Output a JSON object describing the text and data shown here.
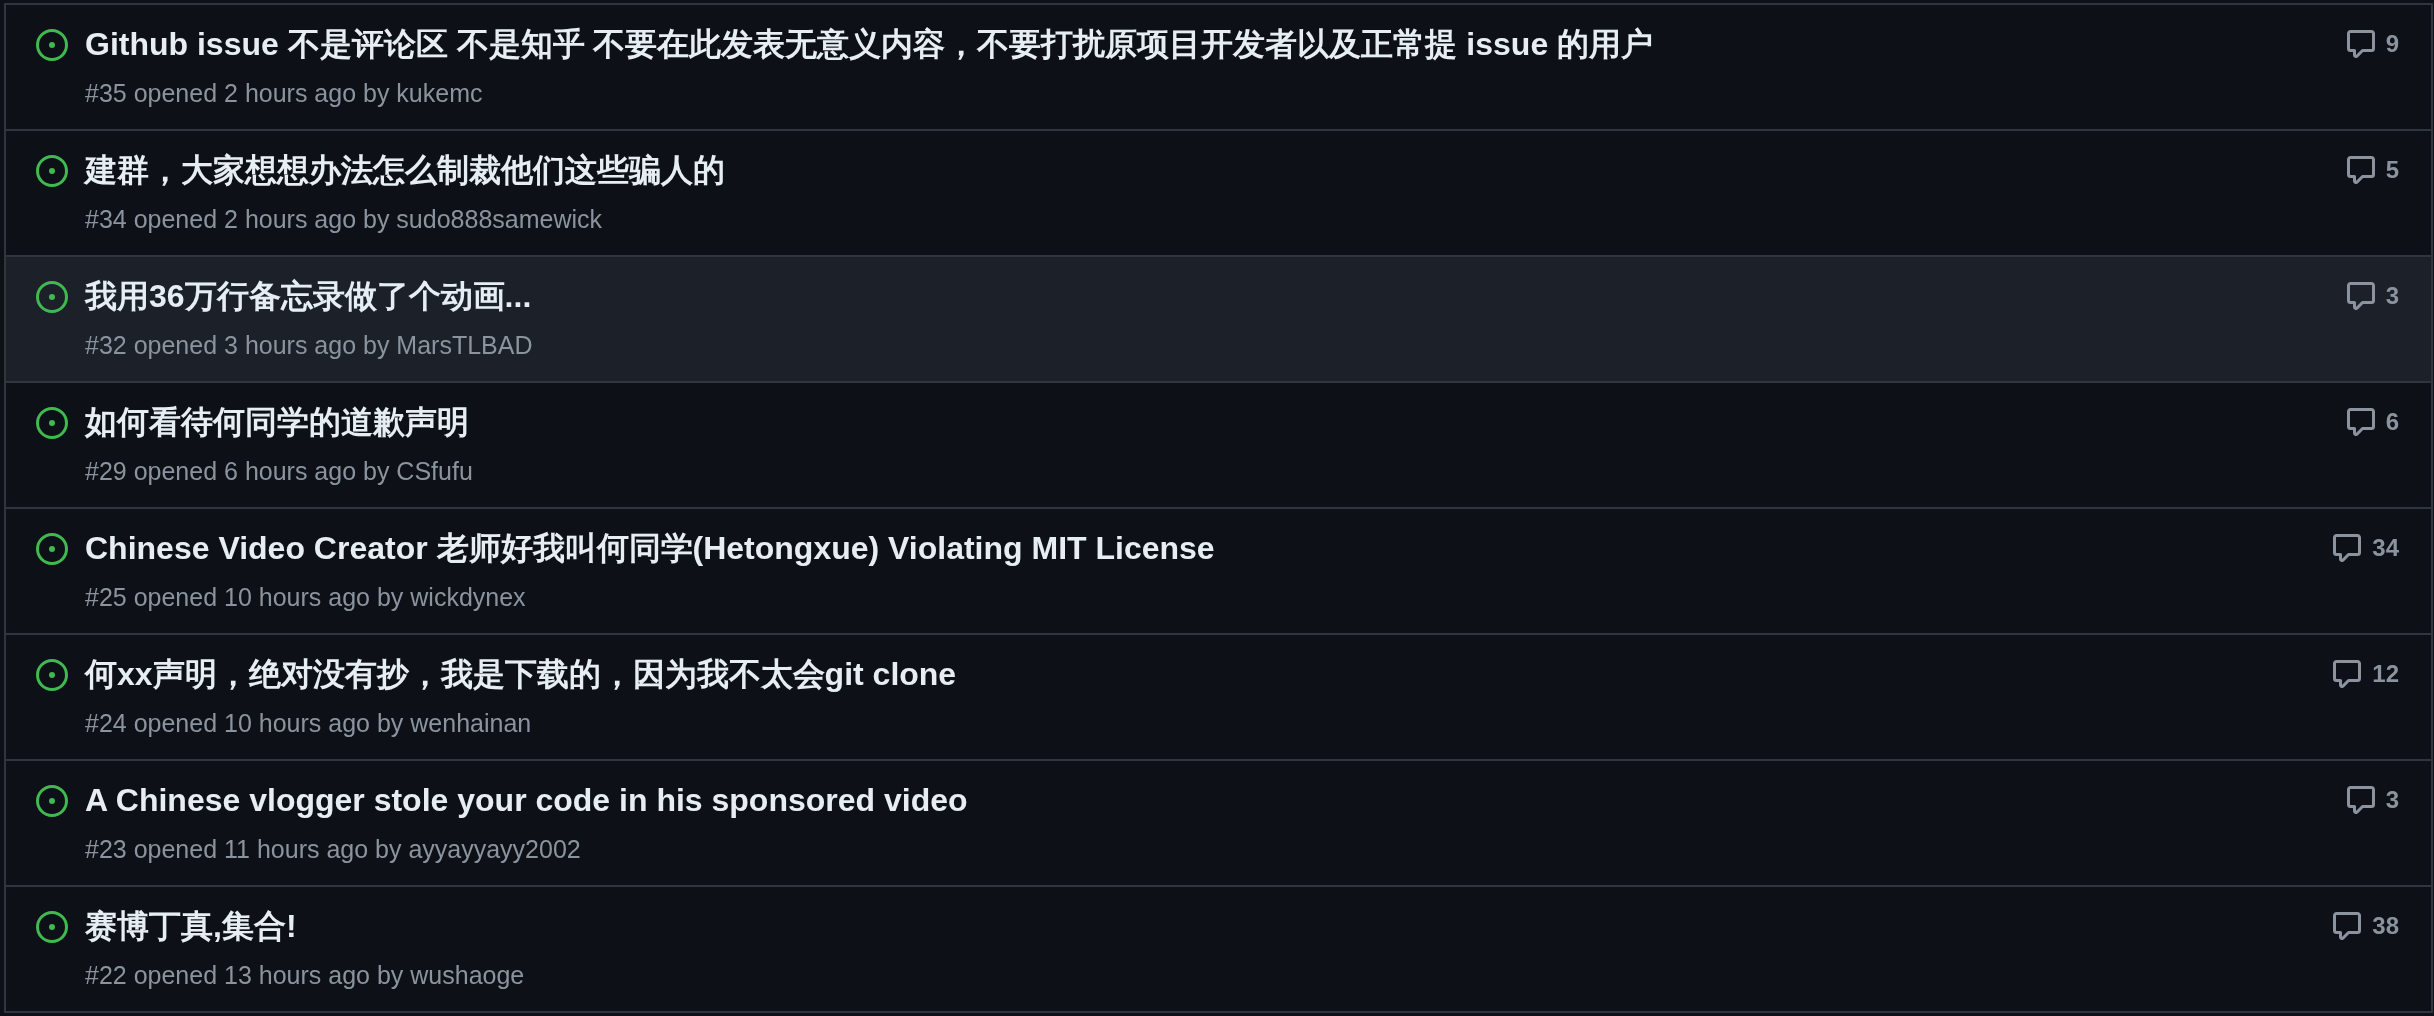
{
  "issues": [
    {
      "title": "Github issue 不是评论区 不是知乎 不要在此发表无意义内容，不要打扰原项目开发者以及正常提 issue 的用户",
      "meta": "#35 opened 2 hours ago by kukemc",
      "comments": "9",
      "hovered": false
    },
    {
      "title": "建群，大家想想办法怎么制裁他们这些骗人的",
      "meta": "#34 opened 2 hours ago by sudo888samewick",
      "comments": "5",
      "hovered": false
    },
    {
      "title": "我用36万行备忘录做了个动画...",
      "meta": "#32 opened 3 hours ago by MarsTLBAD",
      "comments": "3",
      "hovered": true
    },
    {
      "title": "如何看待何同学的道歉声明",
      "meta": "#29 opened 6 hours ago by CSfufu",
      "comments": "6",
      "hovered": false
    },
    {
      "title": "Chinese Video Creator 老师好我叫何同学(Hetongxue) Violating MIT License",
      "meta": "#25 opened 10 hours ago by wickdynex",
      "comments": "34",
      "hovered": false
    },
    {
      "title": "何xx声明，绝对没有抄，我是下载的，因为我不太会git clone",
      "meta": "#24 opened 10 hours ago by wenhainan",
      "comments": "12",
      "hovered": false
    },
    {
      "title": "A Chinese vlogger stole your code in his sponsored video",
      "meta": "#23 opened 11 hours ago by ayyayyayy2002",
      "comments": "3",
      "hovered": false
    },
    {
      "title": "赛博丁真,集合!",
      "meta": "#22 opened 13 hours ago by wushaoge",
      "comments": "38",
      "hovered": false
    }
  ]
}
